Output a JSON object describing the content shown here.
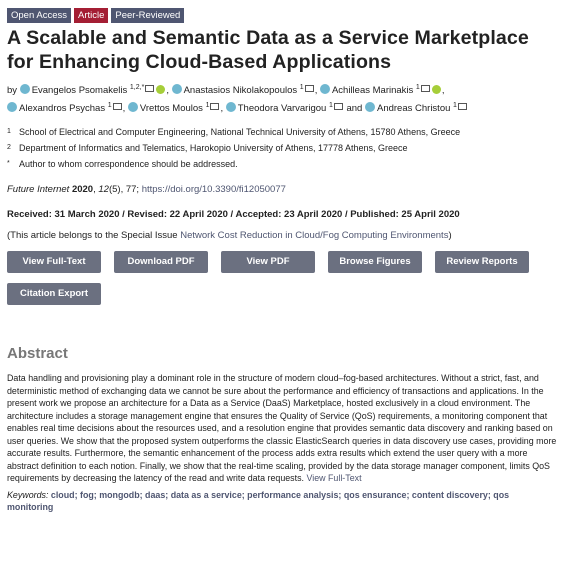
{
  "badges": [
    "Open Access",
    "Article",
    "Peer-Reviewed"
  ],
  "title": "A Scalable and Semantic Data as a Service Marketplace for Enhancing Cloud-Based Applications",
  "authors": {
    "by": "by",
    "list": [
      {
        "name": "Evangelos Psomakelis",
        "sup": "1,2,*"
      },
      {
        "name": "Anastasios Nikolakopoulos",
        "sup": "1"
      },
      {
        "name": "Achilleas Marinakis",
        "sup": "1"
      },
      {
        "name": "Alexandros Psychas",
        "sup": "1"
      },
      {
        "name": "Vrettos Moulos",
        "sup": "1"
      },
      {
        "name": "Theodora Varvarigou",
        "sup": "1"
      },
      {
        "name": "Andreas Christou",
        "sup": "1"
      }
    ],
    "and": "and"
  },
  "affiliations": [
    {
      "num": "1",
      "text": "School of Electrical and Computer Engineering, National Technical University of Athens, 15780 Athens, Greece"
    },
    {
      "num": "2",
      "text": "Department of Informatics and Telematics, Harokopio University of Athens, 17778 Athens, Greece"
    },
    {
      "num": "*",
      "text": "Author to whom correspondence should be addressed."
    }
  ],
  "journal": {
    "name": "Future Internet",
    "year": "2020",
    "volume": "12",
    "issue_pages": "(5), 77; ",
    "doi": "https://doi.org/10.3390/fi12050077"
  },
  "dates": "Received: 31 March 2020 / Revised: 22 April 2020 / Accepted: 23 April 2020 / Published: 25 April 2020",
  "special_issue": {
    "prefix": "(This article belongs to the Special Issue ",
    "link": "Network Cost Reduction in Cloud/Fog Computing Environments",
    "suffix": ")"
  },
  "buttons": [
    "View Full-Text",
    "Download PDF",
    "View PDF",
    "Browse Figures",
    "Review Reports",
    "Citation Export"
  ],
  "abstract": {
    "heading": "Abstract",
    "text": "Data handling and provisioning play a dominant role in the structure of modern cloud–fog-based architectures. Without a strict, fast, and deterministic method of exchanging data we cannot be sure about the performance and efficiency of transactions and applications. In the present work we propose an architecture for a Data as a Service (DaaS) Marketplace, hosted exclusively in a cloud environment. The architecture includes a storage management engine that ensures the Quality of Service (QoS) requirements, a monitoring component that enables real time decisions about the resources used, and a resolution engine that provides semantic data discovery and ranking based on user queries. We show that the proposed system outperforms the classic ElasticSearch queries in data discovery use cases, providing more accurate results. Furthermore, the semantic enhancement of the process adds extra results which extend the user query with a more abstract definition to each notion. Finally, we show that the real-time scaling, provided by the data storage manager component, limits QoS requirements by decreasing the latency of the read and write data requests.",
    "link": "View Full-Text"
  },
  "keywords": {
    "label": "Keywords:",
    "list": "cloud; fog; mongodb; daas; data as a service; performance analysis; qos ensurance; content discovery; qos monitoring"
  }
}
